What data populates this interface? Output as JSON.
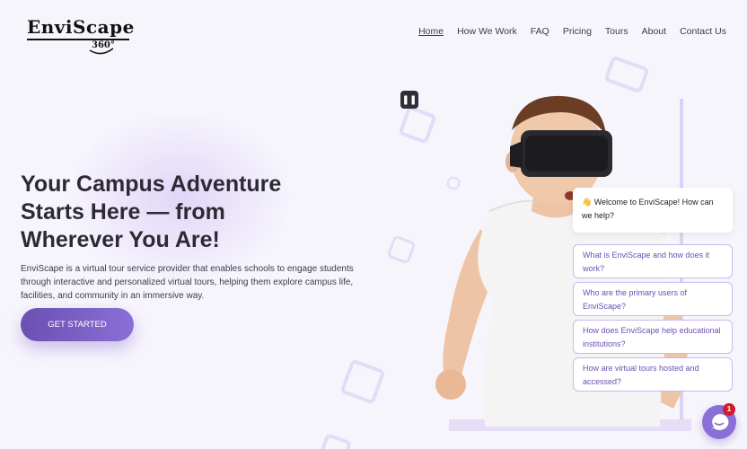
{
  "logo": {
    "main": "EnviScape",
    "sub": "360°"
  },
  "nav": {
    "items": [
      {
        "label": "Home"
      },
      {
        "label": "How We Work"
      },
      {
        "label": "FAQ"
      },
      {
        "label": "Pricing"
      },
      {
        "label": "Tours"
      },
      {
        "label": "About"
      },
      {
        "label": "Contact Us"
      }
    ],
    "active": "Home"
  },
  "hero": {
    "title": "Your Campus Adventure Starts Here — from Wherever You Are!",
    "description": "EnviScape is a virtual tour service provider that enables schools to engage students through interactive and personalized virtual tours, helping them explore campus life, facilities, and community in an immersive way.",
    "cta_label": "GET STARTED"
  },
  "chatbot": {
    "welcome": "👋 Welcome to EnviScape! How can we help?",
    "questions": [
      "What is EnviScape and how does it work?",
      "Who are the primary users of EnviScape?",
      "How does EnviScape help educational institutions?",
      "How are virtual tours hosted and accessed?"
    ],
    "badge_count": "1"
  },
  "colors": {
    "accent": "#8a6fd6",
    "accent_dark": "#6b4fb3",
    "background": "#f7f5fc",
    "badge": "#d11a2a"
  },
  "icons": {
    "chat_launcher": "chat-bubble-icon",
    "top_pill": "pause-icon"
  }
}
